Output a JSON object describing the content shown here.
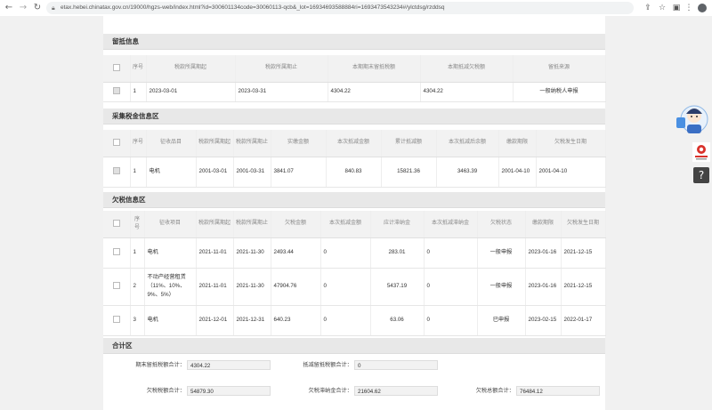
{
  "browser": {
    "url": "etax.hebei.chinatax.gov.cn/19000/hgzs-web/index.html?id=300601134code=30060113-qcb&_lot=16934693588884ri=1693473543234#/ylctdsg/rzddsq",
    "back_icon": "arrow-left-icon",
    "forward_icon": "arrow-right-icon",
    "reload_icon": "reload-icon",
    "share_icon": "share-icon",
    "star_icon": "star-icon",
    "sidepanel_icon": "sidepanel-icon",
    "profile_icon": "avatar-icon"
  },
  "sections": {
    "pledge": "留抵信息",
    "collected": "采集税金信息区",
    "owed": "欠税信息区",
    "total": "合计区"
  },
  "pledge_table": {
    "headers": [
      "",
      "序号",
      "税款所属期起",
      "税款所属期止",
      "本期期末留抵税额",
      "本期抵减欠税额",
      "留抵来源"
    ],
    "rows": [
      {
        "checked": true,
        "cells": [
          "1",
          "2023-03-01",
          "2023-03-31",
          "4304.22",
          "4304.22",
          "一般纳税人申报"
        ]
      }
    ]
  },
  "collected_table": {
    "headers": [
      "",
      "序号",
      "征收品目",
      "税款所属期起",
      "税款所属期止",
      "实缴金额",
      "本次抵减金额",
      "累计抵减额",
      "本次抵减后余额",
      "缴款期限",
      "欠税发生日期"
    ],
    "rows": [
      {
        "checked": true,
        "cells": [
          "1",
          "电机",
          "2001-03-01",
          "2001-03-31",
          "3841.07",
          "840.83",
          "15821.36",
          "3463.39",
          "2001-04-10",
          "2001-04-10"
        ]
      }
    ]
  },
  "owed_table": {
    "headers": [
      "",
      "序号",
      "征收项目",
      "税款所属期起",
      "税款所属期止",
      "欠税金额",
      "本次抵减金额",
      "应计滞纳金",
      "本次抵减滞纳金",
      "欠税状态",
      "缴款期限",
      "欠税发生日期"
    ],
    "rows": [
      {
        "checked": false,
        "cells": [
          "1",
          "电机",
          "2021-11-01",
          "2021-11-30",
          "2493.44",
          "0",
          "283.01",
          "0",
          "一般申报",
          "2023-01-16",
          "2021-12-15"
        ]
      },
      {
        "checked": false,
        "cells": [
          "2",
          "不动产经营租赁（11%、10%、9%、5%）",
          "2021-11-01",
          "2021-11-30",
          "47904.76",
          "0",
          "5437.19",
          "0",
          "一般申报",
          "2023-01-16",
          "2021-12-15"
        ]
      },
      {
        "checked": false,
        "cells": [
          "3",
          "电机",
          "2021-12-01",
          "2021-12-31",
          "640.23",
          "0",
          "63.06",
          "0",
          "已申报",
          "2023-02-15",
          "2022-01-17"
        ]
      }
    ]
  },
  "totals": {
    "pledge_total_label": "期末留抵税额合计：",
    "pledge_total_value": "4304.22",
    "offset_total_label": "抵减留抵税额合计：",
    "offset_total_value": "0",
    "owed_total_label": "欠税税额合计：",
    "owed_total_value": "54879.30",
    "late_fee_total_label": "欠税滞纳金合计：",
    "late_fee_total_value": "21604.62",
    "all_total_label": "欠税总额合计：",
    "all_total_value": "76484.12"
  },
  "widgets": {
    "assistant_icon": "assistant-mascot-icon",
    "logo_icon": "tax-logo-icon",
    "help_icon": "help-icon",
    "help_glyph": "?"
  }
}
